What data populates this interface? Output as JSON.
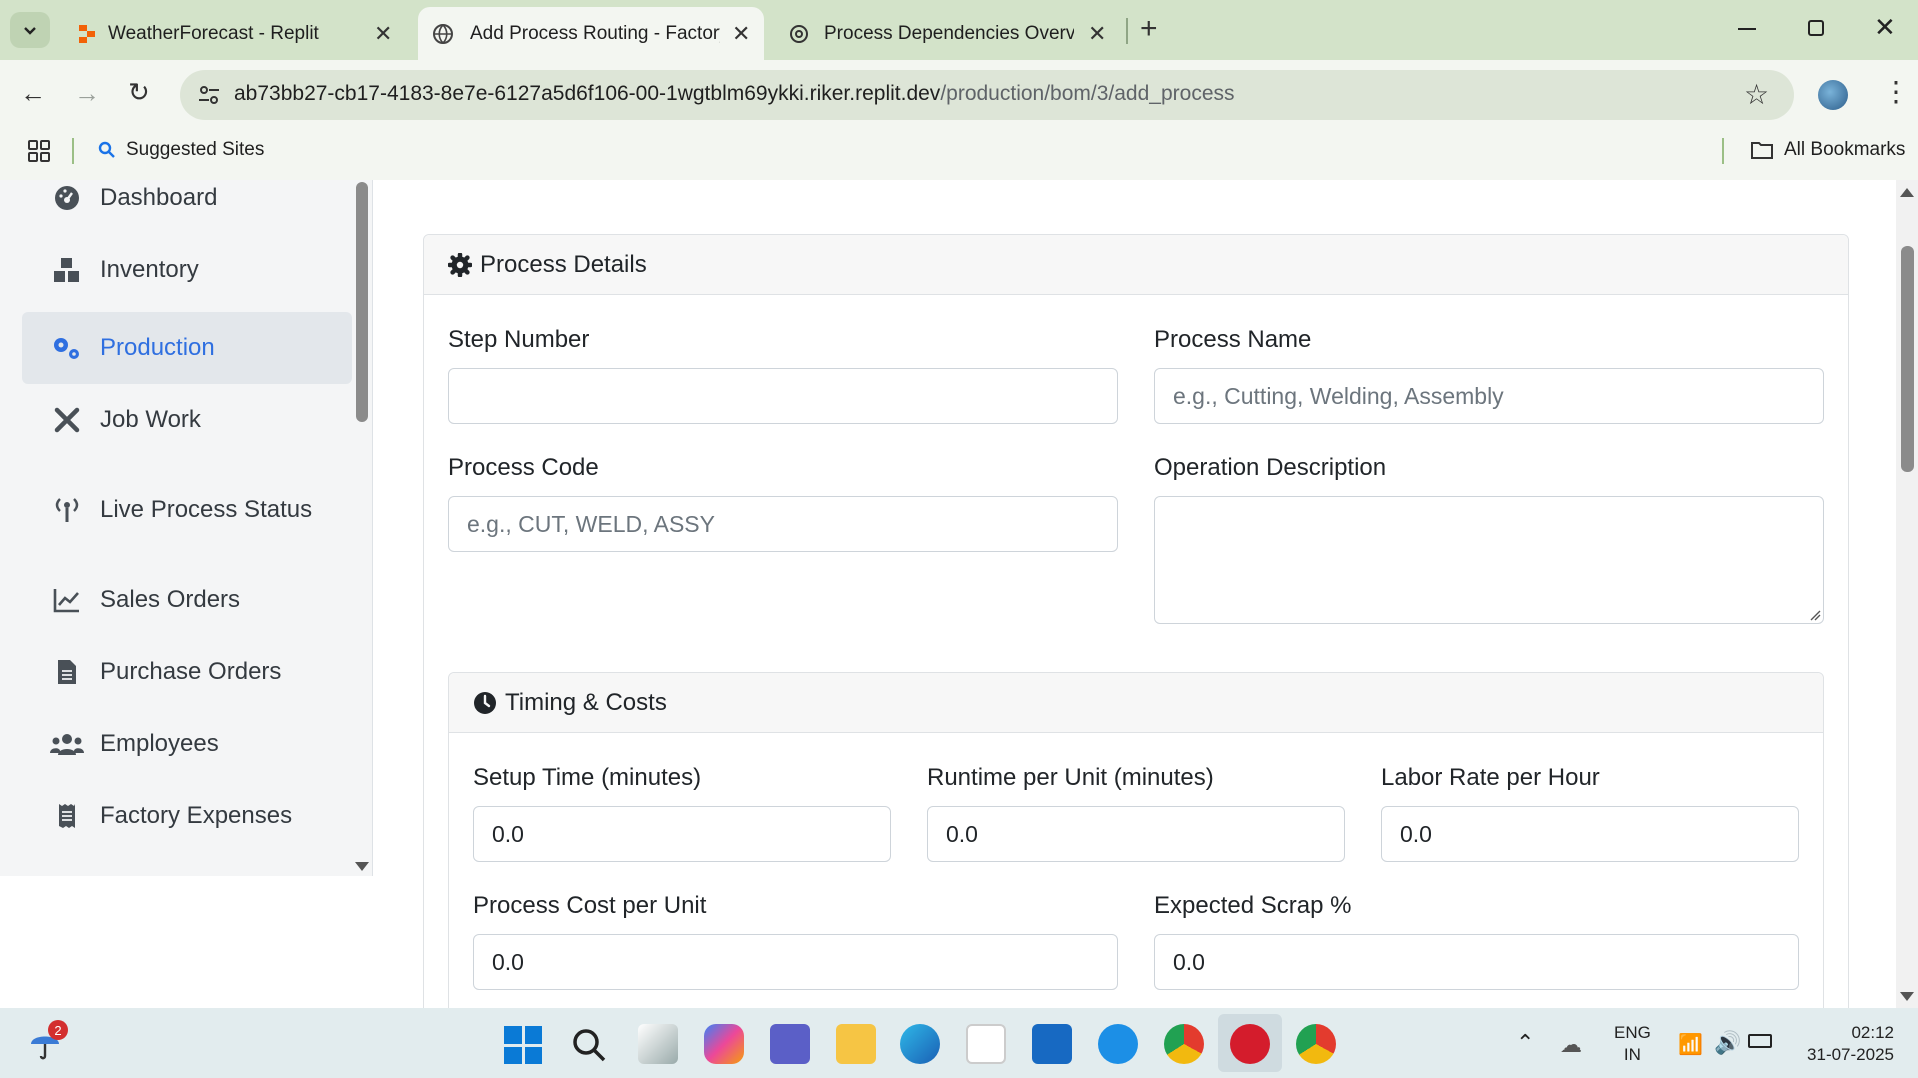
{
  "browser": {
    "tabs": [
      {
        "title": "WeatherForecast - Replit"
      },
      {
        "title": "Add Process Routing - Factory M"
      },
      {
        "title": "Process Dependencies Overview"
      }
    ],
    "url_host": "ab73bb27-cb17-4183-8e7e-6127a5d6f106-00-1wgtblm69ykki.riker.replit.dev",
    "url_path": "/production/bom/3/add_process",
    "bookmarks": {
      "suggested": "Suggested Sites",
      "all": "All Bookmarks"
    }
  },
  "sidebar": {
    "items": [
      {
        "label": "Dashboard",
        "icon": "dashboard-icon"
      },
      {
        "label": "Inventory",
        "icon": "boxes-icon"
      },
      {
        "label": "Production",
        "icon": "cogs-icon",
        "active": true
      },
      {
        "label": "Job Work",
        "icon": "tools-icon"
      },
      {
        "label": "Live Process Status",
        "icon": "broadcast-icon"
      },
      {
        "label": "Sales Orders",
        "icon": "chart-line-icon"
      },
      {
        "label": "Purchase Orders",
        "icon": "file-invoice-icon"
      },
      {
        "label": "Employees",
        "icon": "users-icon"
      },
      {
        "label": "Factory Expenses",
        "icon": "receipt-icon"
      }
    ]
  },
  "form": {
    "section_title": "Process Details",
    "step_number": {
      "label": "Step Number",
      "value": "",
      "placeholder": ""
    },
    "process_name": {
      "label": "Process Name",
      "placeholder": "e.g., Cutting, Welding, Assembly"
    },
    "process_code": {
      "label": "Process Code",
      "placeholder": "e.g., CUT, WELD, ASSY"
    },
    "operation_description": {
      "label": "Operation Description",
      "placeholder": ""
    },
    "timing": {
      "title": "Timing & Costs",
      "setup_time": {
        "label": "Setup Time (minutes)",
        "value": "0.0"
      },
      "runtime_per_unit": {
        "label": "Runtime per Unit (minutes)",
        "value": "0.0"
      },
      "labor_rate": {
        "label": "Labor Rate per Hour",
        "value": "0.0"
      },
      "process_cost": {
        "label": "Process Cost per Unit",
        "value": "0.0"
      },
      "expected_scrap": {
        "label": "Expected Scrap %",
        "value": "0.0"
      }
    }
  },
  "taskbar": {
    "weather_badge": "2",
    "lang": "ENG",
    "region": "IN",
    "time": "02:12",
    "date": "31-07-2025"
  },
  "colors": {
    "accent": "#2f6fe0",
    "tabbar": "#d3e3c9",
    "toolbar": "#f3f6f1"
  }
}
